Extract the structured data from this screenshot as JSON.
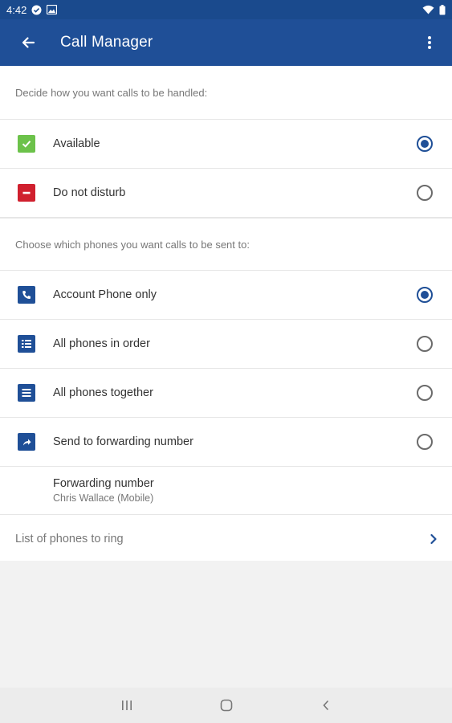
{
  "status_bar": {
    "time": "4:42"
  },
  "app_bar": {
    "title": "Call Manager"
  },
  "availability": {
    "header": "Decide how you want calls to be handled:",
    "options": [
      {
        "label": "Available",
        "selected": true,
        "icon": "check-icon",
        "color": "#6cc24a"
      },
      {
        "label": "Do not disturb",
        "selected": false,
        "icon": "dnd-icon",
        "color": "#d0202e"
      }
    ]
  },
  "routing": {
    "header": "Choose which phones you want calls to be sent to:",
    "options": [
      {
        "label": "Account Phone only",
        "selected": true,
        "icon": "phone-icon"
      },
      {
        "label": "All phones in order",
        "selected": false,
        "icon": "ordered-list-icon"
      },
      {
        "label": "All phones together",
        "selected": false,
        "icon": "list-icon"
      },
      {
        "label": "Send to forwarding number",
        "selected": false,
        "icon": "forward-icon"
      }
    ]
  },
  "forwarding": {
    "title": "Forwarding number",
    "value": "Chris Wallace (Mobile)"
  },
  "phones_link": {
    "label": "List of phones to ring"
  },
  "colors": {
    "primary": "#1f4f97",
    "status_bar": "#1a4a8d",
    "available": "#6cc24a",
    "dnd": "#d0202e"
  }
}
